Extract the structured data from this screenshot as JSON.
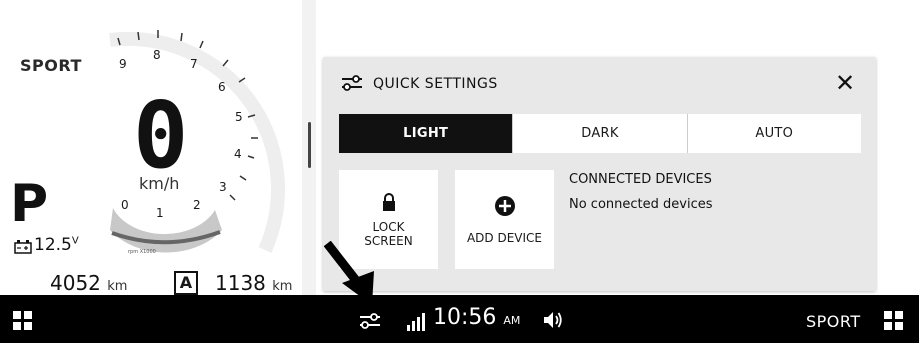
{
  "cluster": {
    "mode": "SPORT",
    "speed": "0",
    "speed_unit": "km/h",
    "gear": "P",
    "voltage": "12.5",
    "voltage_unit": "V",
    "odometer": "4052",
    "trip": "1138",
    "distance_unit": "km",
    "trip_label": "A",
    "rpm_label": "rpm X1000",
    "tach_ticks": [
      "0",
      "1",
      "2",
      "3",
      "4",
      "5",
      "6",
      "7",
      "8",
      "9"
    ]
  },
  "quick_settings": {
    "title": "QUICK SETTINGS",
    "close": "✕",
    "themes": [
      "LIGHT",
      "DARK",
      "AUTO"
    ],
    "active_theme": "LIGHT",
    "lock_label": "LOCK SCREEN",
    "add_label": "ADD DEVICE",
    "connected_heading": "CONNECTED DEVICES",
    "connected_text": "No connected devices"
  },
  "bottom_bar": {
    "time": "10:56",
    "ampm": "AM",
    "mode": "SPORT"
  },
  "icons": [
    "grid-icon",
    "settings-sliders-icon",
    "signal-icon",
    "speaker-icon",
    "lock-icon",
    "add-circle-icon",
    "battery-icon",
    "arrow-indicator"
  ],
  "colors": {
    "bar": "#000000",
    "panel": "#e8e8e8",
    "active": "#111111"
  }
}
